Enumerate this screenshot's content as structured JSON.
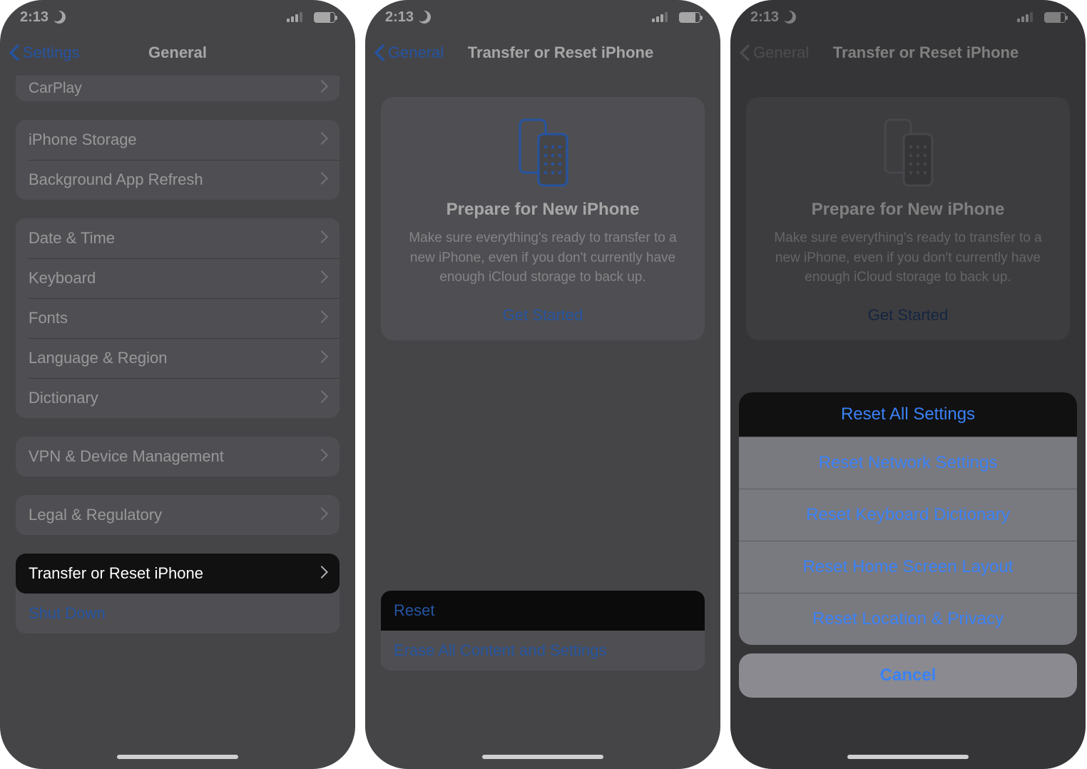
{
  "status": {
    "time": "2:13"
  },
  "phone1": {
    "back": "Settings",
    "title": "General",
    "rows": {
      "carplay": "CarPlay",
      "storage": "iPhone Storage",
      "bgrefresh": "Background App Refresh",
      "datetime": "Date & Time",
      "keyboard": "Keyboard",
      "fonts": "Fonts",
      "language": "Language & Region",
      "dictionary": "Dictionary",
      "vpn": "VPN & Device Management",
      "legal": "Legal & Regulatory",
      "transfer": "Transfer or Reset iPhone",
      "shutdown": "Shut Down"
    }
  },
  "phone2": {
    "back": "General",
    "title": "Transfer or Reset iPhone",
    "card": {
      "heading": "Prepare for New iPhone",
      "body": "Make sure everything's ready to transfer to a new iPhone, even if you don't currently have enough iCloud storage to back up.",
      "cta": "Get Started"
    },
    "rows": {
      "reset": "Reset",
      "erase": "Erase All Content and Settings"
    }
  },
  "phone3": {
    "back": "General",
    "title": "Transfer or Reset iPhone",
    "card": {
      "heading": "Prepare for New iPhone",
      "body": "Make sure everything's ready to transfer to a new iPhone, even if you don't currently have enough iCloud storage to back up.",
      "cta": "Get Started"
    },
    "sheet": {
      "all": "Reset All Settings",
      "network": "Reset Network Settings",
      "keyboard": "Reset Keyboard Dictionary",
      "home": "Reset Home Screen Layout",
      "location": "Reset Location & Privacy",
      "cancel": "Cancel"
    }
  }
}
